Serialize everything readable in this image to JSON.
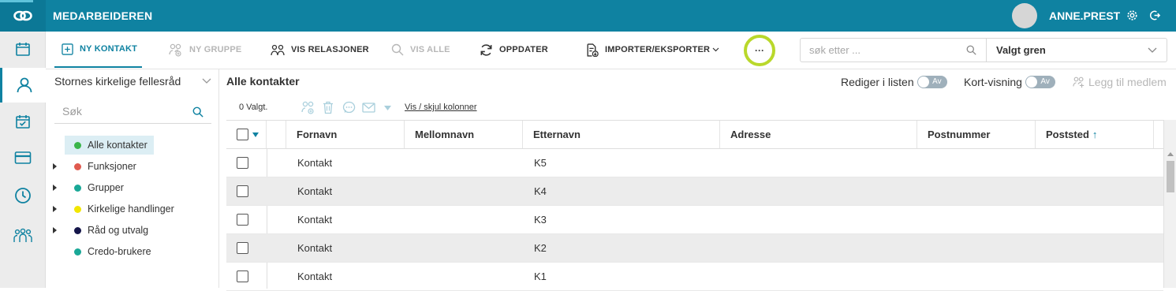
{
  "app": {
    "title": "MEDARBEIDEREN"
  },
  "user": {
    "name": "ANNE.PREST"
  },
  "toolbar": {
    "new_contact": "NY KONTAKT",
    "new_group": "NY GRUPPE",
    "show_relations": "VIS RELASJONER",
    "show_all": "VIS ALLE",
    "refresh": "OPPDATER",
    "import_export": "IMPORTER/EKSPORTER",
    "more": "···",
    "search_placeholder": "søk etter ...",
    "branch": "Valgt gren"
  },
  "sidebar": {
    "org": "Stornes kirkelige fellesråd",
    "search_placeholder": "Søk",
    "tree": [
      {
        "label": "Alle kontakter",
        "color": "#3bb54a",
        "selected": true,
        "expandable": false
      },
      {
        "label": "Funksjoner",
        "color": "#e05a4f",
        "selected": false,
        "expandable": true
      },
      {
        "label": "Grupper",
        "color": "#1aa897",
        "selected": false,
        "expandable": true
      },
      {
        "label": "Kirkelige handlinger",
        "color": "#f2e600",
        "selected": false,
        "expandable": true
      },
      {
        "label": "Råd og utvalg",
        "color": "#15164a",
        "selected": false,
        "expandable": true
      },
      {
        "label": "Credo-brukere",
        "color": "#1aa897",
        "selected": false,
        "expandable": false
      }
    ]
  },
  "main": {
    "title": "Alle kontakter",
    "edit_in_list": "Rediger i listen",
    "card_view": "Kort-visning",
    "toggle_off": "Av",
    "add_member": "Legg til medlem",
    "selected_count": "0 Valgt.",
    "show_hide_columns": "Vis / skjul kolonner"
  },
  "table": {
    "columns": [
      "Fornavn",
      "Mellomnavn",
      "Etternavn",
      "Adresse",
      "Postnummer",
      "Poststed"
    ],
    "sort_indicator": "↑",
    "rows": [
      {
        "fornavn": "Kontakt",
        "mellomnavn": "",
        "etternavn": "K5",
        "adresse": "",
        "postnummer": "",
        "poststed": ""
      },
      {
        "fornavn": "Kontakt",
        "mellomnavn": "",
        "etternavn": "K4",
        "adresse": "",
        "postnummer": "",
        "poststed": ""
      },
      {
        "fornavn": "Kontakt",
        "mellomnavn": "",
        "etternavn": "K3",
        "adresse": "",
        "postnummer": "",
        "poststed": ""
      },
      {
        "fornavn": "Kontakt",
        "mellomnavn": "",
        "etternavn": "K2",
        "adresse": "",
        "postnummer": "",
        "poststed": ""
      },
      {
        "fornavn": "Kontakt",
        "mellomnavn": "",
        "etternavn": "K1",
        "adresse": "",
        "postnummer": "",
        "poststed": ""
      }
    ]
  },
  "colors": {
    "brand": "#0f82a1",
    "highlight_ring": "#b9d82b"
  }
}
